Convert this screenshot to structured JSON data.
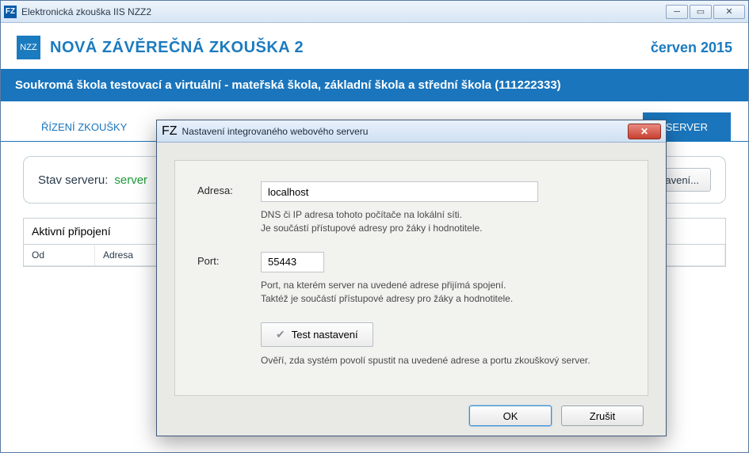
{
  "window": {
    "title": "Elektronická zkouška IIS NZZ2",
    "icon_label": "FZ"
  },
  "brand": {
    "logo_text": "NZZ",
    "title": "NOVÁ ZÁVĚREČNÁ ZKOUŠKA 2",
    "period": "červen 2015"
  },
  "school_bar": "Soukromá škola testovací a virtuální - mateřská škola, základní škola a střední škola (111222333)",
  "tabs": {
    "management": "ŘÍZENÍ ZKOUŠKY",
    "server": "SERVER"
  },
  "status": {
    "label": "Stav serveru:",
    "value": "server",
    "settings_button": "Nastavení..."
  },
  "connections": {
    "heading": "Aktivní připojení",
    "col_from": "Od",
    "col_address": "Adresa"
  },
  "dialog": {
    "title": "Nastavení integrovaného webového serveru",
    "address_label": "Adresa:",
    "address_value": "localhost",
    "address_help": "DNS či IP adresa tohoto počítače na lokální síti.\nJe součástí přístupové adresy pro žáky i hodnotitele.",
    "port_label": "Port:",
    "port_value": "55443",
    "port_help": "Port, na kterém server na uvedené adrese přijímá spojení.\nTaktéž je součástí přístupové adresy pro žáky a hodnotitele.",
    "test_label": "Test nastavení",
    "test_help": "Ověří, zda systém povolí spustit na uvedené adrese a portu zkouškový server.",
    "ok": "OK",
    "cancel": "Zrušit"
  }
}
